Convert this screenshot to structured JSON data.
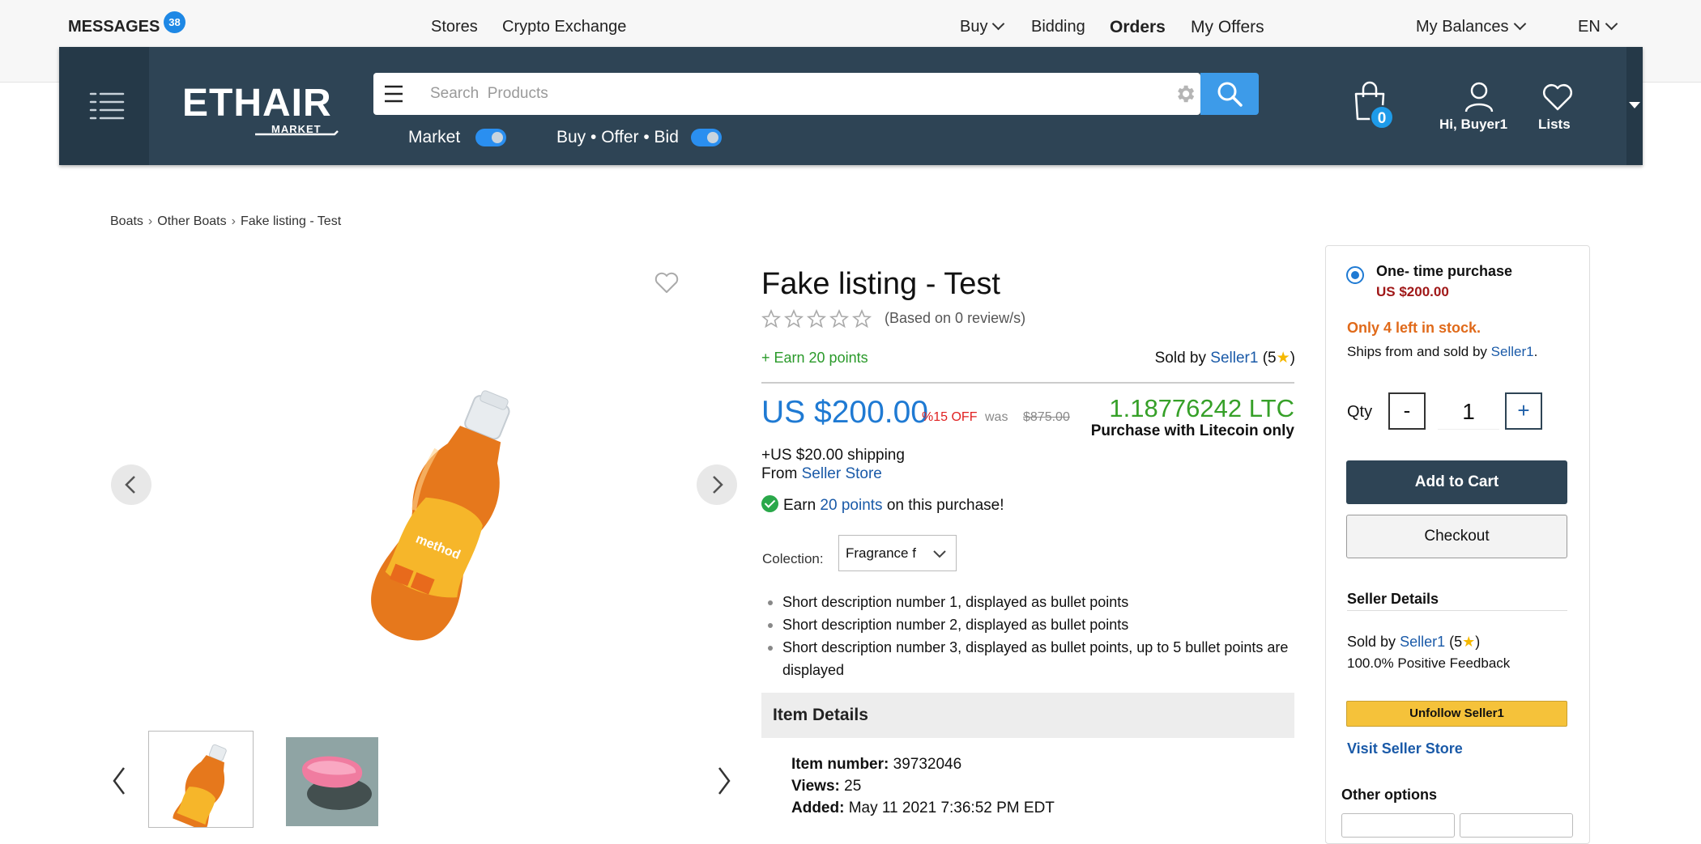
{
  "top_nav": {
    "messages_label": "MESSAGES",
    "messages_count": "38",
    "stores": "Stores",
    "crypto": "Crypto Exchange",
    "buy": "Buy",
    "bidding": "Bidding",
    "orders": "Orders",
    "my_offers": "My Offers",
    "my_balances": "My Balances",
    "language": "EN"
  },
  "header": {
    "logo_main": "ETHAIR",
    "logo_sub": "MARKET",
    "search_placeholder": "Search  Products",
    "toggle_market": "Market",
    "toggle_buy_offer_bid": "Buy • Offer • Bid",
    "cart_count": "0",
    "user_label": "Hi, Buyer1",
    "lists_label": "Lists"
  },
  "breadcrumb": [
    "Boats",
    "Other Boats",
    "Fake listing - Test"
  ],
  "product": {
    "title": "Fake listing - Test",
    "rating_stars": 0,
    "review_text": "(Based on 0 review/s)",
    "earn_top": "+ Earn 20 points",
    "sold_by_prefix": "Sold by",
    "seller_name": "Seller1",
    "seller_rating_open": "(5",
    "seller_rating_close": ")",
    "price": "US $200.00",
    "discount": "%15 OFF",
    "was_label": "was",
    "was_price": "$875.00",
    "ltc_price": "1.18776242 LTC",
    "ltc_note": "Purchase with Litecoin only",
    "shipping": "+US $20.00 shipping",
    "from_prefix": "From",
    "from_store": "Seller Store",
    "earn_prefix": "Earn",
    "earn_points": "20 points",
    "earn_suffix": "on this purchase!",
    "colection_label": "Colection:",
    "colection_value": "Fragrance f",
    "bullets": [
      "Short description number 1, displayed as bullet points",
      "Short description number 2, displayed as bullet points",
      "Short description number 3, displayed as bullet points, up to 5 bullet points are displayed"
    ],
    "item_details_title": "Item Details",
    "item_number_label": "Item number:",
    "item_number": "39732046",
    "views_label": "Views:",
    "views": "25",
    "added_label": "Added:",
    "added": "May 11 2021 7:36:52 PM EDT"
  },
  "buybox": {
    "purchase_type": "One- time purchase",
    "purchase_price": "US $200.00",
    "stock": "Only 4 left in stock.",
    "ships_prefix": "Ships from and sold by",
    "ships_seller": "Seller1",
    "ships_suffix": ".",
    "qty_label": "Qty",
    "qty_minus": "-",
    "qty_value": "1",
    "qty_plus": "+",
    "add_to_cart": "Add to Cart",
    "checkout": "Checkout",
    "seller_details_title": "Seller Details",
    "sold_by_prefix": "Sold by",
    "seller_name": "Seller1",
    "seller_rating_open": "(5",
    "seller_rating_close": ")",
    "feedback": "100.0% Positive Feedback",
    "unfollow": "Unfollow Seller1",
    "visit_store": "Visit Seller Store",
    "other_options": "Other options"
  },
  "colors": {
    "header_bg": "#2e4455",
    "accent_blue": "#1f7ad3",
    "ltc_green": "#36a028",
    "stock_orange": "#e06a1a",
    "unfollow_yellow": "#f5c23a"
  }
}
